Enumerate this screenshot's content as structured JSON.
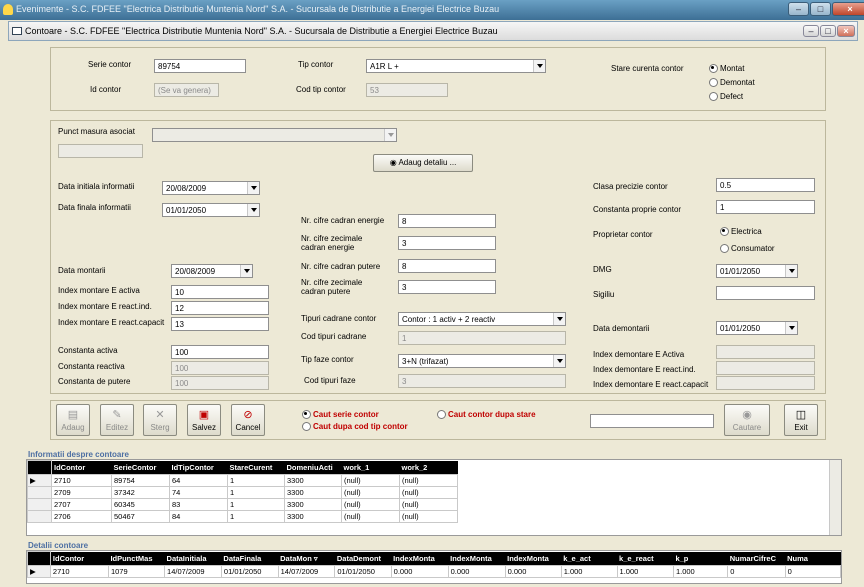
{
  "outer_window": {
    "title": "Evenimente - S.C. FDFEE \"Electrica Distributie Muntenia Nord\" S.A. - Sucursala de Distributie a Energiei Electrice Buzau"
  },
  "inner_window": {
    "title": "Contoare - S.C. FDFEE \"Electrica Distributie Muntenia Nord\" S.A. - Sucursala de Distributie a Energiei Electrice Buzau"
  },
  "top": {
    "serie_contor_label": "Serie contor",
    "serie_contor_value": "89754",
    "id_contor_label": "Id contor",
    "id_contor_value": "(Se va genera)",
    "tip_contor_label": "Tip contor",
    "tip_contor_value": "A1R L +",
    "cod_tip_contor_label": "Cod tip contor",
    "cod_tip_contor_value": "53",
    "stare_label": "Stare curenta contor",
    "stare_options": [
      "Montat",
      "Demontat",
      "Defect"
    ]
  },
  "middle": {
    "punct_label": "Punct masura asociat",
    "punct_value": "",
    "adaug_detaliu": "Adaug detaliu ...",
    "data_initiala_label": "Data initiala informatii",
    "data_initiala_value": "20/08/2009",
    "data_finala_label": "Data finala informatii",
    "data_finala_value": "01/01/2050",
    "data_montarii_label": "Data montarii",
    "data_montarii_value": "20/08/2009",
    "index_activa_label": "Index montare E activa",
    "index_activa_value": "10",
    "index_react_ind_label": "Index montare E react.ind.",
    "index_react_ind_value": "12",
    "index_react_cap_label": "Index montare E react.capacit",
    "index_react_cap_value": "13",
    "constanta_activa_label": "Constanta activa",
    "constanta_activa_value": "100",
    "constanta_reactiva_label": "Constanta reactiva",
    "constanta_reactiva_value": "100",
    "constanta_putere_label": "Constanta de putere",
    "constanta_putere_value": "100",
    "nr_cifre_energie_label": "Nr. cifre cadran energie",
    "nr_cifre_energie_value": "8",
    "nr_zecimale_energie_label": "Nr. cifre zecimale cadran energie",
    "nr_zecimale_energie_value": "3",
    "nr_cifre_putere_label": "Nr. cifre cadran putere",
    "nr_cifre_putere_value": "8",
    "nr_zecimale_putere_label": "Nr. cifre zecimale cadran putere",
    "nr_zecimale_putere_value": "3",
    "tipuri_cadrane_label": "Tipuri cadrane contor",
    "tipuri_cadrane_value": "Contor : 1 activ + 2 reactiv",
    "cod_tipuri_cadrane_label": "Cod tipuri cadrane",
    "cod_tipuri_cadrane_value": "1",
    "tip_faze_label": "Tip faze contor",
    "tip_faze_value": "3+N (trifazat)",
    "cod_tipuri_faze_label": "Cod tipuri faze",
    "cod_tipuri_faze_value": "3",
    "clasa_label": "Clasa precizie contor",
    "clasa_value": "0.5",
    "constanta_proprie_label": "Constanta proprie contor",
    "constanta_proprie_value": "1",
    "proprietar_label": "Proprietar contor",
    "proprietar_options": [
      "Electrica",
      "Consumator"
    ],
    "dmg_label": "DMG",
    "dmg_value": "01/01/2050",
    "sigiliu_label": "Sigiliu",
    "sigiliu_value": "",
    "data_demontarii_label": "Data demontarii",
    "data_demontarii_value": "01/01/2050",
    "idx_dem_activa_label": "Index demontare E Activa",
    "idx_dem_react_ind_label": "Index demontare E react.ind.",
    "idx_dem_react_cap_label": "Index demontare E react.capacit"
  },
  "toolbar": {
    "adaug": "Adaug",
    "editez": "Editez",
    "sterg": "Sterg",
    "salvez": "Salvez",
    "cancel": "Cancel",
    "caut_serie": "Caut serie contor",
    "caut_cod_tip": "Caut dupa cod tip contor",
    "caut_stare": "Caut contor dupa stare",
    "search_value": "",
    "cautare": "Cautare",
    "exit": "Exit"
  },
  "info_grid": {
    "title": "Informatii despre contoare",
    "columns": [
      "IdContor",
      "SerieContor",
      "IdTipContor",
      "StareCurent",
      "DomeniuActi",
      "work_1",
      "work_2"
    ],
    "rows": [
      [
        "2710",
        "89754",
        "64",
        "1",
        "3300",
        "(null)",
        "(null)"
      ],
      [
        "2709",
        "37342",
        "74",
        "1",
        "3300",
        "(null)",
        "(null)"
      ],
      [
        "2707",
        "60345",
        "83",
        "1",
        "3300",
        "(null)",
        "(null)"
      ],
      [
        "2706",
        "50467",
        "84",
        "1",
        "3300",
        "(null)",
        "(null)"
      ]
    ]
  },
  "detalii_grid": {
    "title": "Detalii contoare",
    "columns": [
      "IdContor",
      "IdPunctMas",
      "DataInitiala",
      "DataFinala",
      "DataMon ▿",
      "DataDemont",
      "IndexMonta",
      "IndexMonta",
      "IndexMonta",
      "k_e_act",
      "k_e_react",
      "k_p",
      "NumarCifreC",
      "Numa"
    ],
    "rows": [
      [
        "2710",
        "1079",
        "14/07/2009",
        "01/01/2050",
        "14/07/2009",
        "01/01/2050",
        "0.000",
        "0.000",
        "0.000",
        "1.000",
        "1.000",
        "1.000",
        "0",
        "0"
      ]
    ]
  }
}
